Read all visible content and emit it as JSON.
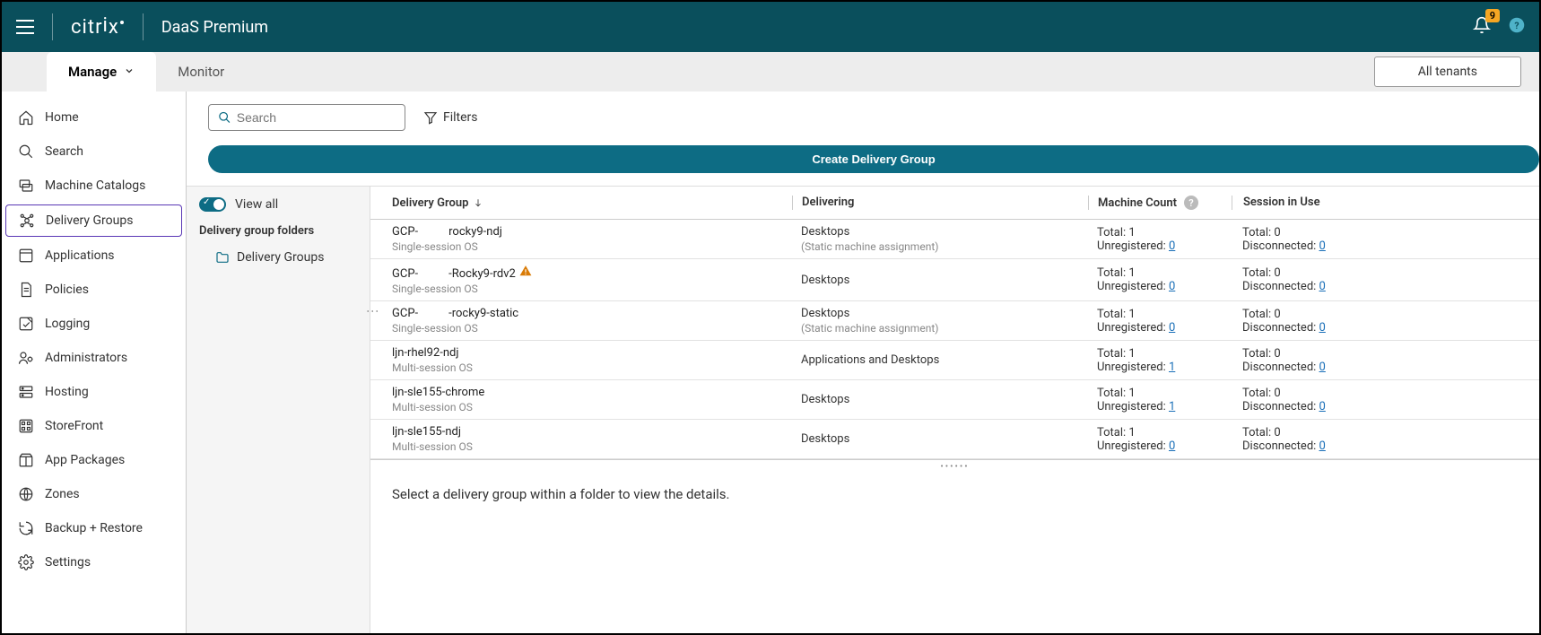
{
  "header": {
    "product_name": "DaaS Premium",
    "notification_count": "9"
  },
  "tabs": {
    "manage": "Manage",
    "monitor": "Monitor",
    "tenants": "All tenants"
  },
  "sidebar": {
    "home": "Home",
    "search": "Search",
    "machine_catalogs": "Machine Catalogs",
    "delivery_groups": "Delivery Groups",
    "applications": "Applications",
    "policies": "Policies",
    "logging": "Logging",
    "administrators": "Administrators",
    "hosting": "Hosting",
    "storefront": "StoreFront",
    "app_packages": "App Packages",
    "zones": "Zones",
    "backup_restore": "Backup + Restore",
    "settings": "Settings"
  },
  "toolbar": {
    "search_placeholder": "Search",
    "filters": "Filters",
    "create_btn": "Create Delivery Group"
  },
  "folder_panel": {
    "view_all": "View all",
    "section_title": "Delivery group folders",
    "folder_name": "Delivery Groups"
  },
  "columns": {
    "delivery_group": "Delivery Group",
    "delivering": "Delivering",
    "machine_count": "Machine Count",
    "session_in_use": "Session in Use"
  },
  "rows": [
    {
      "name_prefix": "GCP-",
      "name_suffix": "rocky9-ndj",
      "redacted": true,
      "warn": false,
      "os": "Single-session OS",
      "delivering": "Desktops",
      "delivering_sub": "(Static machine assignment)",
      "mc_total": "Total: 1",
      "mc_unreg_label": "Unregistered: ",
      "mc_unreg_val": "0",
      "su_total": "Total: 0",
      "su_disc_label": "Disconnected: ",
      "su_disc_val": "0"
    },
    {
      "name_prefix": "GCP-",
      "name_suffix": "-Rocky9-rdv2",
      "redacted": true,
      "warn": true,
      "os": "Single-session OS",
      "delivering": "Desktops",
      "delivering_sub": "",
      "mc_total": "Total: 1",
      "mc_unreg_label": "Unregistered: ",
      "mc_unreg_val": "0",
      "su_total": "Total: 0",
      "su_disc_label": "Disconnected: ",
      "su_disc_val": "0"
    },
    {
      "name_prefix": "GCP-",
      "name_suffix": "-rocky9-static",
      "redacted": true,
      "warn": false,
      "os": "Single-session OS",
      "delivering": "Desktops",
      "delivering_sub": "(Static machine assignment)",
      "mc_total": "Total: 1",
      "mc_unreg_label": "Unregistered: ",
      "mc_unreg_val": "0",
      "su_total": "Total: 0",
      "su_disc_label": "Disconnected: ",
      "su_disc_val": "0"
    },
    {
      "name_prefix": "ljn-rhel92-ndj",
      "name_suffix": "",
      "redacted": false,
      "warn": false,
      "os": "Multi-session OS",
      "delivering": "Applications and Desktops",
      "delivering_sub": "",
      "mc_total": "Total: 1",
      "mc_unreg_label": "Unregistered: ",
      "mc_unreg_val": "1",
      "su_total": "Total: 0",
      "su_disc_label": "Disconnected: ",
      "su_disc_val": "0"
    },
    {
      "name_prefix": "ljn-sle155-chrome",
      "name_suffix": "",
      "redacted": false,
      "warn": false,
      "os": "Multi-session OS",
      "delivering": "Desktops",
      "delivering_sub": "",
      "mc_total": "Total: 1",
      "mc_unreg_label": "Unregistered: ",
      "mc_unreg_val": "1",
      "su_total": "Total: 0",
      "su_disc_label": "Disconnected: ",
      "su_disc_val": "0"
    },
    {
      "name_prefix": "ljn-sle155-ndj",
      "name_suffix": "",
      "redacted": false,
      "warn": false,
      "os": "Multi-session OS",
      "delivering": "Desktops",
      "delivering_sub": "",
      "mc_total": "Total: 1",
      "mc_unreg_label": "Unregistered: ",
      "mc_unreg_val": "0",
      "su_total": "Total: 0",
      "su_disc_label": "Disconnected: ",
      "su_disc_val": "0"
    }
  ],
  "detail_hint": "Select a delivery group within a folder to view the details."
}
